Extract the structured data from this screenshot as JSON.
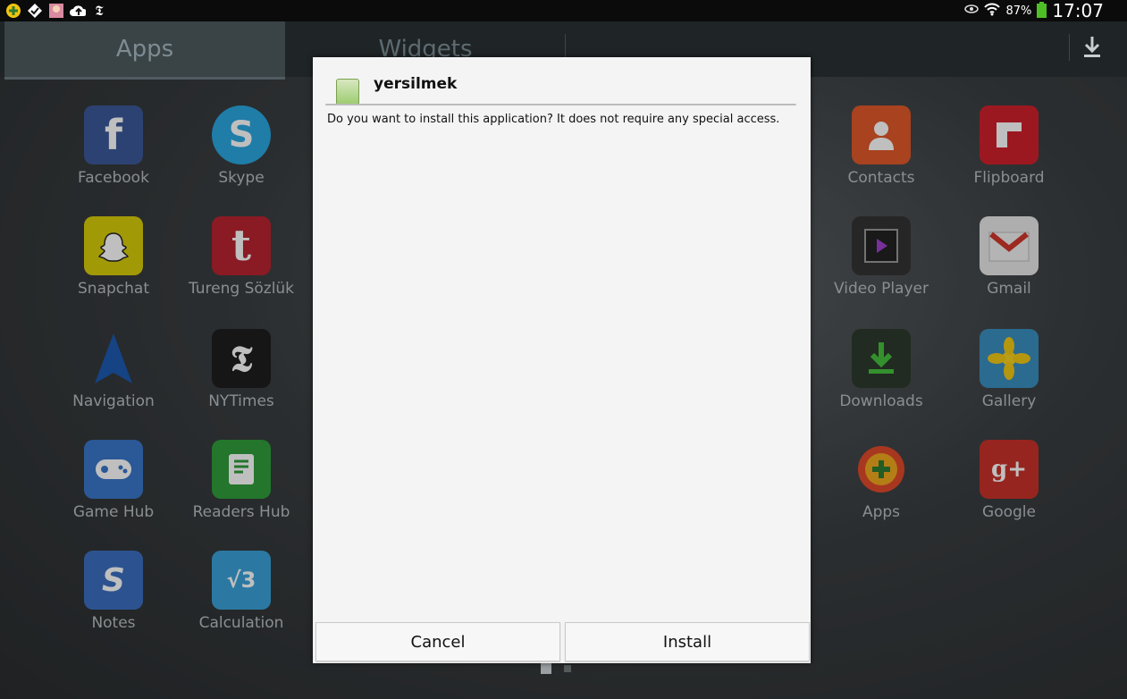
{
  "statusbar": {
    "left_icons": [
      "plus-circle-icon",
      "check-badge-icon",
      "photo-icon",
      "cloud-upload-icon",
      "nytimes-icon"
    ],
    "battery_percent": "87%",
    "time": "17:07"
  },
  "tabs": [
    {
      "label": "Apps"
    },
    {
      "label": "Widgets"
    }
  ],
  "apps_left": [
    {
      "label": "Facebook",
      "color": "#3b5998",
      "glyph": "f"
    },
    {
      "label": "Skype",
      "color": "#2aa7e0",
      "glyph": "S"
    },
    {
      "label": "Snapchat",
      "color": "#f5e70a",
      "glyph": "👻"
    },
    {
      "label": "Tureng Sözlük",
      "color": "#c4263a",
      "glyph": "t"
    },
    {
      "label": "Navigation",
      "color": "#1a5fb4",
      "glyph": "▲"
    },
    {
      "label": "NYTimes",
      "color": "#222222",
      "glyph": "𝕿"
    },
    {
      "label": "Game Hub",
      "color": "#3a76c8",
      "glyph": "🎮"
    },
    {
      "label": "Readers Hub",
      "color": "#2f9e3a",
      "glyph": "▤"
    },
    {
      "label": "Notes",
      "color": "#3b6fc0",
      "glyph": "S"
    },
    {
      "label": "Calculation",
      "color": "#3aa2d8",
      "glyph": "√3"
    }
  ],
  "apps_right": [
    {
      "label": "Contacts",
      "color": "#e0582a",
      "glyph": "👤"
    },
    {
      "label": "Flipboard",
      "color": "#d0202c",
      "glyph": "F"
    },
    {
      "label": "Video Player",
      "color": "#3a3a3a",
      "glyph": "▶"
    },
    {
      "label": "Gmail",
      "color": "#e8e8e8",
      "glyph": "M"
    },
    {
      "label": "Downloads",
      "color": "#3d8f3d",
      "glyph": "⬇"
    },
    {
      "label": "Gallery",
      "color": "#e7c31e",
      "glyph": "✿"
    },
    {
      "label": "Apps",
      "color": "#f0a81e",
      "glyph": "+"
    },
    {
      "label": "Google",
      "color": "#d0392b",
      "glyph": "g+"
    }
  ],
  "dialog": {
    "app_name": "yersilmek",
    "message": "Do you want to install this application? It does not require any special access.",
    "cancel_label": "Cancel",
    "install_label": "Install"
  }
}
